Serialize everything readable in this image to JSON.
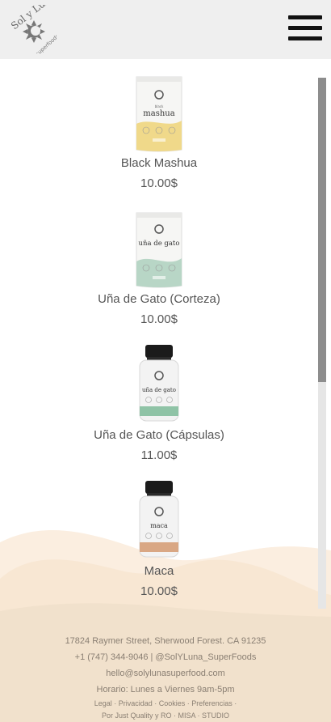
{
  "header": {
    "logo": {
      "brand": "Sol y Luna",
      "sub": "superfoods",
      "icon": "sun-moon-logo"
    },
    "menu_icon": "hamburger-menu-icon"
  },
  "products": [
    {
      "name": "Black Mashua",
      "price": "10.00$",
      "pack_type": "pouch",
      "pack_label": "mashua",
      "pack_small": "black",
      "accent": "#f0d98a"
    },
    {
      "name": "Uña de Gato (Corteza)",
      "price": "10.00$",
      "pack_type": "pouch",
      "pack_label": "uña de gato",
      "pack_small": "",
      "accent": "#b8d6c6"
    },
    {
      "name": "Uña de Gato (Cápsulas)",
      "price": "11.00$",
      "pack_type": "bottle",
      "pack_label": "uña de gato",
      "pack_small": "",
      "accent": "#8fc3a6"
    },
    {
      "name": "Maca",
      "price": "10.00$",
      "pack_type": "bottle",
      "pack_label": "maca",
      "pack_small": "",
      "accent": "#d9a784"
    }
  ],
  "footer": {
    "address": "17824 Raymer Street, Sherwood Forest. CA 91235",
    "phone_social": "+1 (747) 344-9046 | @SolYLuna_SuperFoods",
    "email": "hello@solylunasuperfood.com",
    "hours": "Horario: Lunes a Viernes 9am-5pm",
    "legal": "Legal · Privacidad · Cookies · Preferencias ·",
    "credit": "Por Just Quality y RO · MISA · STUDIO"
  },
  "colors": {
    "header_bg": "#efefef",
    "footer_wave_light": "#fbeee0",
    "footer_wave_dark": "#f1e1cc",
    "text": "#555555",
    "footer_text": "#8a7f73"
  }
}
